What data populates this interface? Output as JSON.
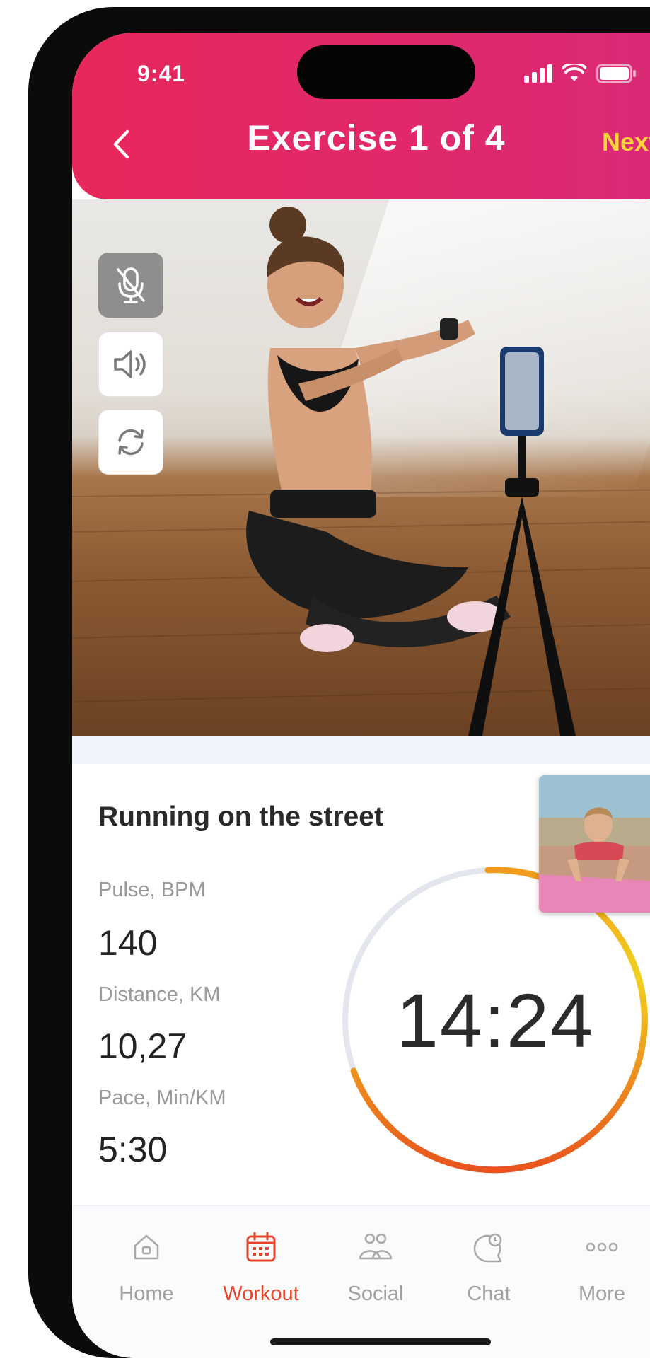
{
  "status_bar": {
    "time": "9:41"
  },
  "header": {
    "title": "Exercise 1 of 4",
    "next_label": "Next"
  },
  "controls": [
    "microphone-off-icon",
    "speaker-icon",
    "switch-camera-icon"
  ],
  "exercise": {
    "name": "Running on the street",
    "stats": [
      {
        "label": "Pulse, BPM",
        "value": "140"
      },
      {
        "label": "Distance, KM",
        "value": "10,27"
      },
      {
        "label": "Pace, Min/KM",
        "value": "5:30"
      }
    ],
    "timer": "14:24"
  },
  "tabs": [
    {
      "label": "Home",
      "icon": "home-icon"
    },
    {
      "label": "Workout",
      "icon": "calendar-icon",
      "active": true
    },
    {
      "label": "Social",
      "icon": "people-icon"
    },
    {
      "label": "Chat",
      "icon": "chat-icon"
    },
    {
      "label": "More",
      "icon": "more-icon"
    }
  ],
  "colors": {
    "header": "#e8275a",
    "accent_next": "#ffd33a",
    "active_tab": "#e5452d",
    "timer_gradient_start": "#f0d21e",
    "timer_gradient_end": "#e8531e"
  }
}
